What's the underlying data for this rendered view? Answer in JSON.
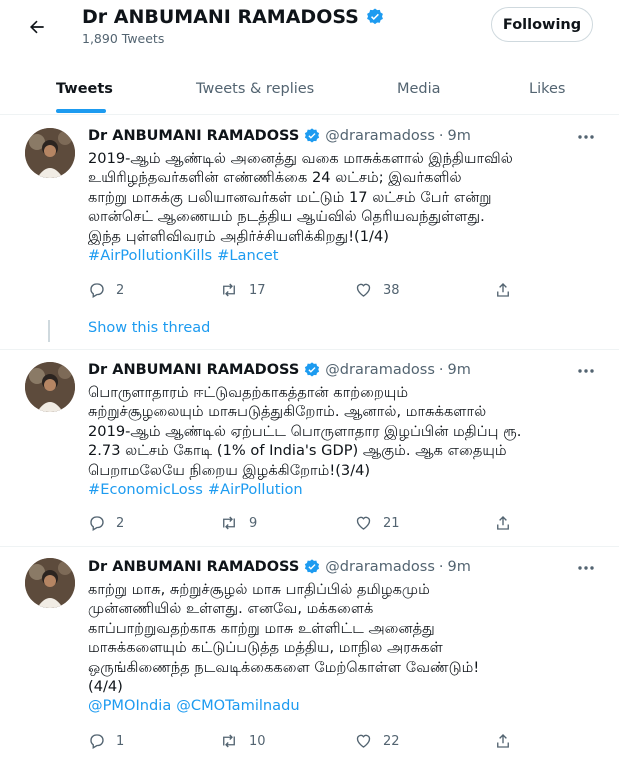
{
  "header": {
    "profile_name": "Dr ANBUMANI RAMADOSS",
    "tweet_count": "1,890 Tweets",
    "following_label": "Following"
  },
  "tabs": [
    {
      "label": "Tweets",
      "active": true
    },
    {
      "label": "Tweets & replies",
      "active": false
    },
    {
      "label": "Media",
      "active": false
    },
    {
      "label": "Likes",
      "active": false
    }
  ],
  "show_thread_label": "Show this thread",
  "tweets": [
    {
      "author": "Dr ANBUMANI RAMADOSS",
      "handle": "@draramadoss",
      "time": "9m",
      "lines": [
        "2019-ஆம் ஆண்டில் அனைத்து வகை மாசுக்களால் இந்தியாவில்",
        "உயிரிழந்தவர்களின் எண்ணிக்கை 24 லட்சம்; இவர்களில்",
        "காற்று மாசுக்கு பலியானவர்கள் மட்டும் 17 லட்சம் பேர் என்று",
        "லான்செட் ஆணையம் நடத்திய ஆய்வில் தெரியவந்துள்ளது.",
        "இந்த புள்ளிவிவரம்  அதிர்ச்சியளிக்கிறது!(1/4)"
      ],
      "hashtags": [
        "#AirPollutionKills",
        "#Lancet"
      ],
      "replies": "2",
      "retweets": "17",
      "likes": "38"
    },
    {
      "author": "Dr ANBUMANI RAMADOSS",
      "handle": "@draramadoss",
      "time": "9m",
      "lines": [
        "பொருளாதாரம் ஈட்டுவதற்காகத்தான் காற்றையும்",
        "சுற்றுச்சூழலையும் மாசுபடுத்துகிறோம். ஆனால், மாசுக்களால்",
        "2019-ஆம் ஆண்டில் ஏற்பட்ட பொருளாதார இழப்பின் மதிப்பு ரூ.",
        "2.73 லட்சம் கோடி (1% of India's GDP) ஆகும். ஆக எதையும்",
        "பெறாமலேயே நிறைய இழக்கிறோம்!(3/4)"
      ],
      "hashtags": [
        "#EconomicLoss",
        "#AirPollution"
      ],
      "replies": "2",
      "retweets": "9",
      "likes": "21"
    },
    {
      "author": "Dr ANBUMANI RAMADOSS",
      "handle": "@draramadoss",
      "time": "9m",
      "lines": [
        "காற்று மாசு, சுற்றுச்சூழல் மாசு பாதிப்பில் தமிழகமும்",
        "முன்னணியில் உள்ளது. எனவே, மக்களைக்",
        "காப்பாற்றுவதற்காக  காற்று மாசு உள்ளிட்ட அனைத்து",
        "மாசுக்களையும் கட்டுப்படுத்த மத்திய, மாநில அரசுகள்",
        "ஒருங்கிணைந்த நடவடிக்கைகளை மேற்கொள்ள வேண்டும்!",
        "(4/4)"
      ],
      "hashtags": [
        "@PMOIndia",
        "@CMOTamilnadu"
      ],
      "replies": "1",
      "retweets": "10",
      "likes": "22"
    }
  ],
  "colors": {
    "accent": "#1d9bf0",
    "text_primary": "#0f1419",
    "text_secondary": "#536471",
    "border": "#eff3f4"
  },
  "icons": [
    "back-arrow-icon",
    "verified-badge-icon",
    "more-icon",
    "reply-icon",
    "retweet-icon",
    "like-icon",
    "share-icon"
  ]
}
